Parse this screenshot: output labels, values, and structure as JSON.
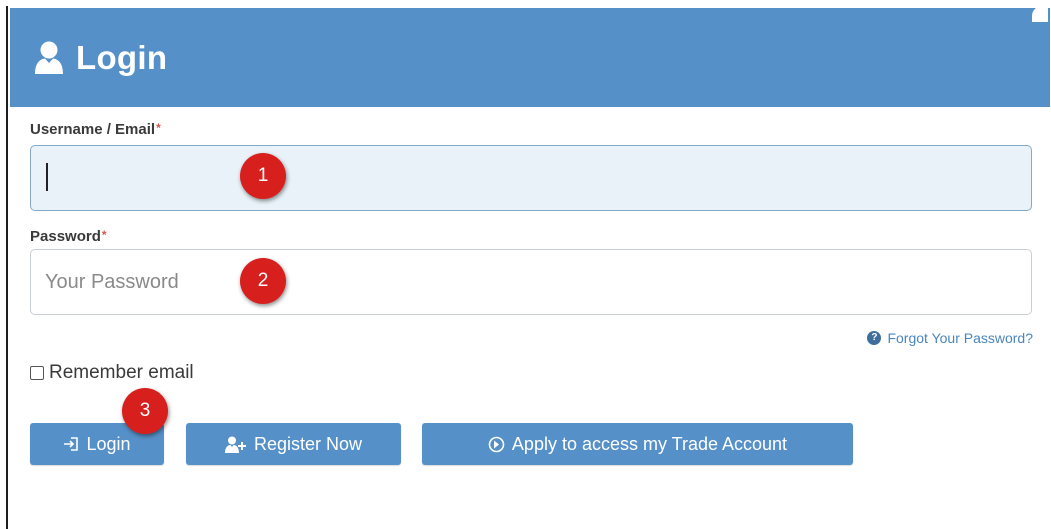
{
  "header": {
    "title": "Login",
    "icon": "user-icon",
    "color": "#5690c8"
  },
  "form": {
    "username": {
      "label": "Username / Email",
      "required_mark": "*",
      "value": "",
      "placeholder": ""
    },
    "password": {
      "label": "Password",
      "required_mark": "*",
      "value": "",
      "placeholder": "Your Password"
    },
    "forgot_link": "Forgot Your Password?",
    "forgot_icon": "question-circle-icon",
    "remember": {
      "label": "Remember email",
      "checked": false
    }
  },
  "buttons": {
    "login": {
      "label": "Login",
      "icon": "sign-in-icon"
    },
    "register": {
      "label": "Register Now",
      "icon": "user-plus-icon"
    },
    "apply": {
      "label": "Apply to access my Trade Account",
      "icon": "arrow-circle-icon"
    }
  },
  "annotations": {
    "badge_1": "1",
    "badge_2": "2",
    "badge_3": "3",
    "badge_color": "#d7201e"
  }
}
